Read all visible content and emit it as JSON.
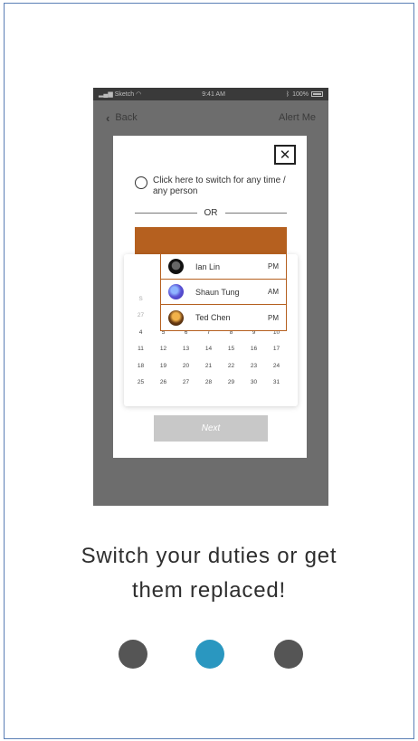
{
  "status_bar": {
    "carrier": "Sketch",
    "time": "9:41 AM",
    "battery": "100%"
  },
  "nav": {
    "back_label": "Back",
    "action_label": "Alert Me"
  },
  "modal": {
    "close_glyph": "✕",
    "radio_label": "Click here to switch for any time / any person",
    "or_label": "OR",
    "persons": [
      {
        "name": "Ian Lin",
        "period": "PM"
      },
      {
        "name": "Shaun Tung",
        "period": "AM"
      },
      {
        "name": "Ted Chen",
        "period": "PM"
      }
    ],
    "calendar": {
      "rows": [
        [
          "S",
          "",
          "",
          "",
          "",
          "",
          ""
        ],
        [
          "27",
          "",
          "",
          "",
          "",
          "",
          ""
        ],
        [
          "4",
          "5",
          "6",
          "7",
          "8",
          "9",
          "10"
        ],
        [
          "11",
          "12",
          "13",
          "14",
          "15",
          "16",
          "17"
        ],
        [
          "18",
          "19",
          "20",
          "21",
          "22",
          "23",
          "24"
        ],
        [
          "25",
          "26",
          "27",
          "28",
          "29",
          "30",
          "31"
        ]
      ]
    },
    "next_label": "Next"
  },
  "caption": {
    "line1": "Switch your duties or get",
    "line2": "them replaced!"
  },
  "pagination": {
    "dots": [
      {
        "color": "#555555",
        "active": false
      },
      {
        "color": "#2a97c0",
        "active": true
      },
      {
        "color": "#555555",
        "active": false
      }
    ]
  },
  "colors": {
    "accent_orange": "#b5601f",
    "overlay_gray": "#6d6d6d",
    "frame_border": "#5b7fb5"
  }
}
